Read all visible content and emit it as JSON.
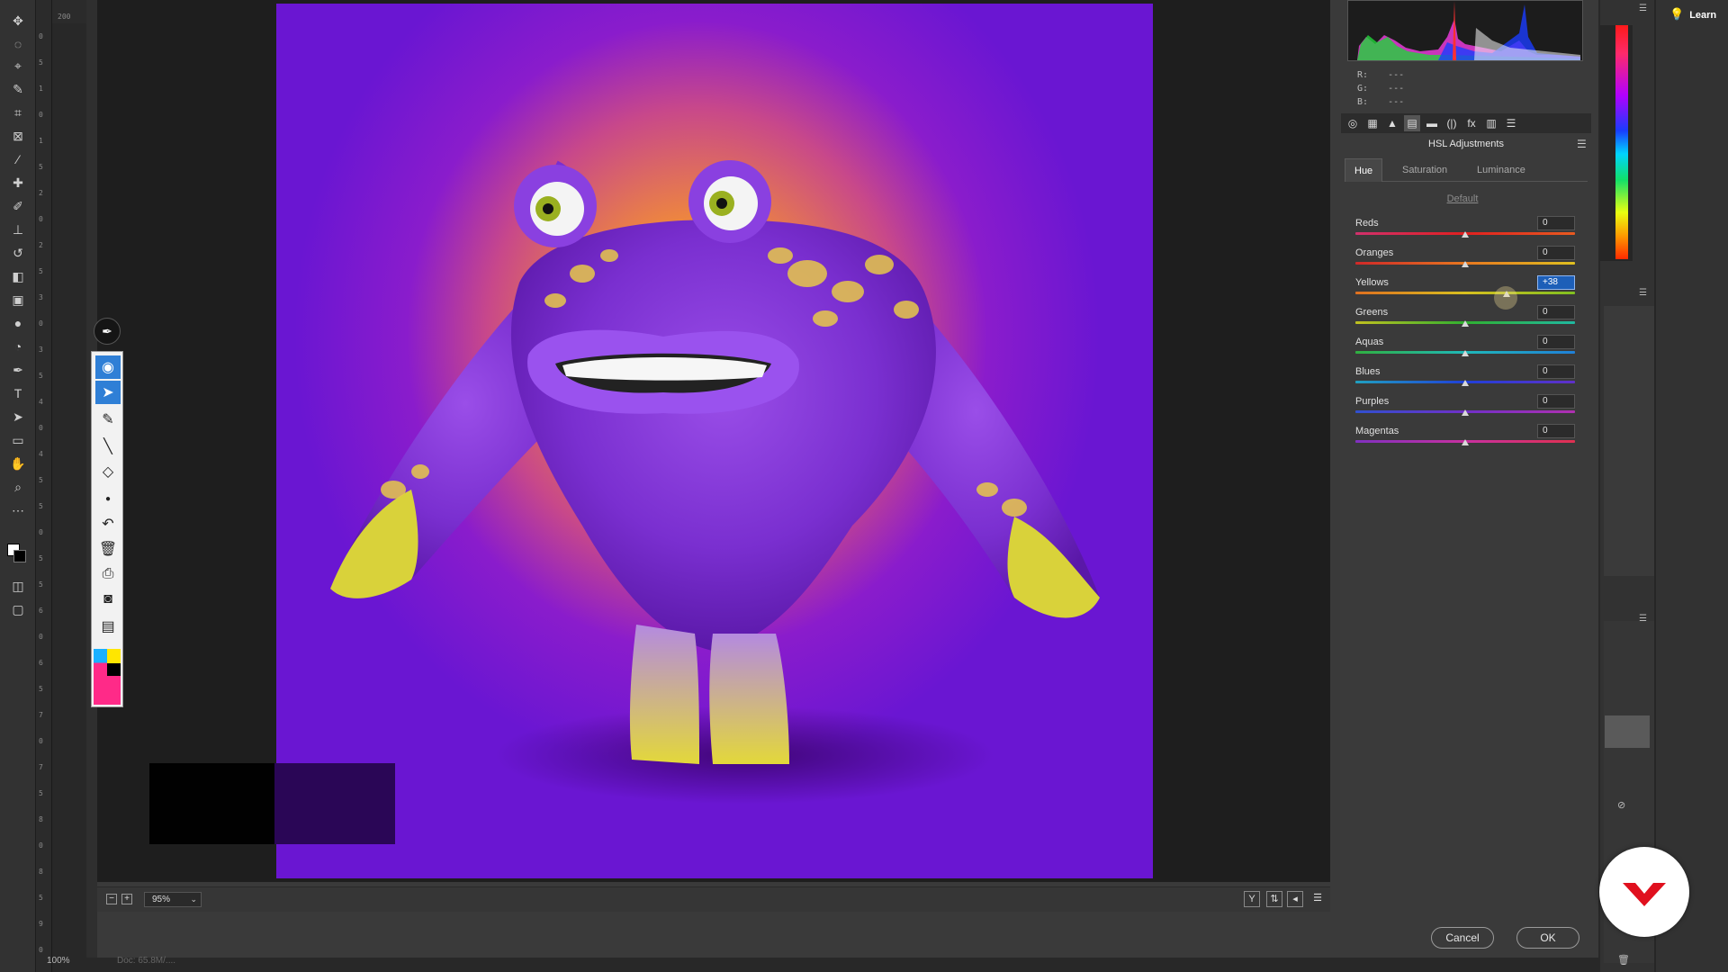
{
  "ruler": {
    "top_label": "200",
    "marks": [
      "0",
      "5",
      "1",
      "0",
      "1",
      "5",
      "2",
      "0",
      "2",
      "5",
      "3",
      "0",
      "3",
      "5",
      "4",
      "0",
      "4",
      "5",
      "5",
      "0",
      "5",
      "5",
      "6",
      "0",
      "6",
      "5",
      "7",
      "0",
      "7",
      "5",
      "8",
      "0",
      "8",
      "5",
      "9",
      "0"
    ]
  },
  "status": {
    "zoom": "100%",
    "doc": "Doc: 65.8M/...."
  },
  "canvas": {
    "zoom_level": "95%"
  },
  "rgb_readout": {
    "r_label": "R:",
    "r": "---",
    "g_label": "G:",
    "g": "---",
    "b_label": "B:",
    "b": "---"
  },
  "panel": {
    "title": "HSL Adjustments",
    "tabs": [
      "Hue",
      "Saturation",
      "Luminance"
    ],
    "active_tab": "Hue",
    "default_link": "Default",
    "sliders": [
      {
        "label": "Reds",
        "value": "0",
        "level": 0
      },
      {
        "label": "Oranges",
        "value": "0",
        "level": 0
      },
      {
        "label": "Yellows",
        "value": "+38",
        "level": 38
      },
      {
        "label": "Greens",
        "value": "0",
        "level": 0
      },
      {
        "label": "Aquas",
        "value": "0",
        "level": 0
      },
      {
        "label": "Blues",
        "value": "0",
        "level": 0
      },
      {
        "label": "Purples",
        "value": "0",
        "level": 0
      },
      {
        "label": "Magentas",
        "value": "0",
        "level": 0
      }
    ]
  },
  "buttons": {
    "cancel": "Cancel",
    "ok": "OK"
  },
  "learn": {
    "label": "Learn"
  },
  "icons": {
    "ps_tools": [
      "move-icon",
      "lasso-icon",
      "polygon-lasso-icon",
      "quick-select-icon",
      "crop-icon",
      "frame-icon",
      "eyedropper-icon",
      "healing-icon",
      "brush-icon",
      "stamp-icon",
      "history-brush-icon",
      "eraser-icon",
      "gradient-icon",
      "blur-icon",
      "dodge-icon",
      "pen-icon",
      "type-icon",
      "path-select-icon",
      "rectangle-icon",
      "hand-icon",
      "zoom-icon",
      "more-icon"
    ],
    "acr_tools": [
      "eye-icon",
      "pointer-icon",
      "brush-icon",
      "line-icon",
      "eraser-icon",
      "dot-icon",
      "undo-icon",
      "trash-icon",
      "printer-icon",
      "camera-icon",
      "clipboard-icon"
    ]
  },
  "colors": {
    "accent": "#2f7fd6",
    "badge": "#e0101e"
  }
}
